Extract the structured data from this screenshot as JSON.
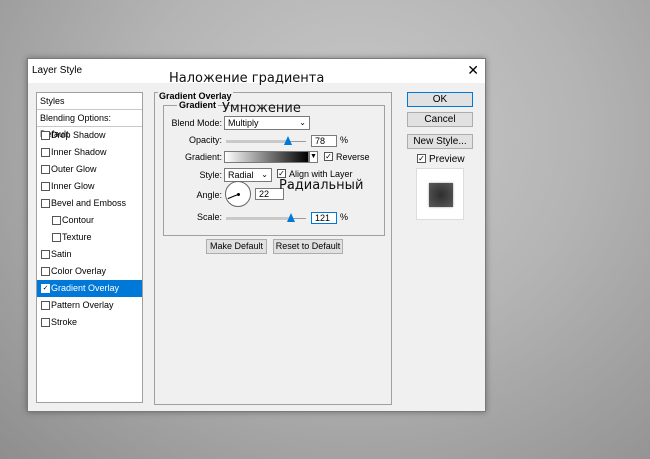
{
  "dialog": {
    "title": "Layer Style",
    "close_glyph": "✕"
  },
  "style_list": {
    "header": "Styles",
    "blending_options": "Blending Options: Default",
    "items": [
      {
        "label": "Drop Shadow",
        "checked": false,
        "sub": false,
        "selected": false
      },
      {
        "label": "Inner Shadow",
        "checked": false,
        "sub": false,
        "selected": false
      },
      {
        "label": "Outer Glow",
        "checked": false,
        "sub": false,
        "selected": false
      },
      {
        "label": "Inner Glow",
        "checked": false,
        "sub": false,
        "selected": false
      },
      {
        "label": "Bevel and Emboss",
        "checked": false,
        "sub": false,
        "selected": false
      },
      {
        "label": "Contour",
        "checked": false,
        "sub": true,
        "selected": false
      },
      {
        "label": "Texture",
        "checked": false,
        "sub": true,
        "selected": false
      },
      {
        "label": "Satin",
        "checked": false,
        "sub": false,
        "selected": false
      },
      {
        "label": "Color Overlay",
        "checked": false,
        "sub": false,
        "selected": false
      },
      {
        "label": "Gradient Overlay",
        "checked": true,
        "sub": false,
        "selected": true
      },
      {
        "label": "Pattern Overlay",
        "checked": false,
        "sub": false,
        "selected": false
      },
      {
        "label": "Stroke",
        "checked": false,
        "sub": false,
        "selected": false
      }
    ]
  },
  "gradient_overlay": {
    "section_title": "Gradient Overlay",
    "group_title": "Gradient",
    "blend_mode_label": "Blend Mode:",
    "blend_mode_value": "Multiply",
    "opacity_label": "Opacity:",
    "opacity_value": "78",
    "opacity_unit": "%",
    "opacity_level": 0.78,
    "gradient_label": "Gradient:",
    "reverse_label": "Reverse",
    "reverse_checked": true,
    "style_label": "Style:",
    "style_value": "Radial",
    "align_label": "Align with Layer",
    "align_checked": true,
    "angle_label": "Angle:",
    "angle_value": "22",
    "angle_unit": "°",
    "angle_degrees": 22,
    "scale_label": "Scale:",
    "scale_value": "121",
    "scale_unit": "%",
    "scale_level": 0.81,
    "make_default": "Make Default",
    "reset_default": "Reset to Default"
  },
  "side_buttons": {
    "ok": "OK",
    "cancel": "Cancel",
    "new_style": "New Style...",
    "preview_label": "Preview",
    "preview_checked": true
  },
  "annotations": {
    "gradient_overlay_ru": "Наложение градиента",
    "multiply_ru": "Умножение",
    "radial_ru": "Радиальный"
  },
  "colors": {
    "accent": "#0078d7",
    "dialog_bg": "#f0f0f0"
  }
}
